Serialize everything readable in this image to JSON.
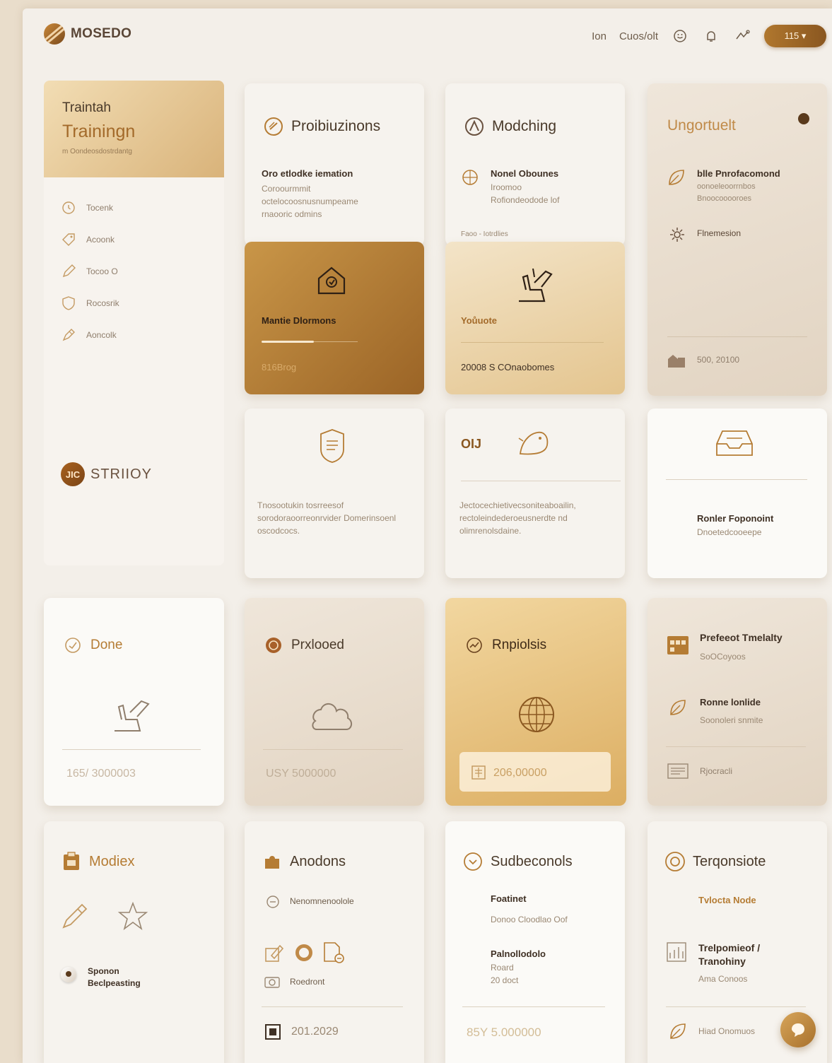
{
  "header": {
    "logo_text": "MOSEDO",
    "nav_links": [
      "Ion",
      "Cuos/olt"
    ],
    "pill_label": "115 ▾"
  },
  "sidebar": {
    "head_title": "Traintah",
    "head_big": "Trainingn",
    "head_sub": "m Oondeosdostrdantg",
    "items": [
      {
        "label": "Tocenk"
      },
      {
        "label": "Acoonk"
      },
      {
        "label": "Tocoo O"
      },
      {
        "label": "Rocosrik"
      },
      {
        "label": "Aoncolk"
      }
    ],
    "brand_badge": "JIC",
    "brand_text": "STRIIOY"
  },
  "cards": {
    "proiputzinons": {
      "title": "Proibiuzinons",
      "item_title": "Oro etlodke iemation",
      "item_lines": [
        "Coroourmmit",
        "octelocoosnusnumpeame",
        "rnaooric odmins"
      ]
    },
    "mantie": {
      "title": "Mantie Dlormons",
      "value": "816Brog"
    },
    "modching": {
      "title": "Modching",
      "item_title": "Nonel Obounes",
      "item_lines": [
        "Iroomoo",
        "Rofiondeodode lof"
      ],
      "meta": "Faoo - Iotrdlies"
    },
    "youdote": {
      "title": "Yoůuote",
      "value": "20008 S COnaobomes"
    },
    "ungortuelt": {
      "title": "Ungortuelt",
      "item1_title": "blle Pnrofacomond",
      "item1_lines": [
        "oonoeleoorrnbos",
        "Bnoocooooroes"
      ],
      "item2": "Flnemesion",
      "footer": "500, 20100"
    },
    "row2a": {
      "text": "Tnosootukin tosrreesof sorodoraoorreonrvider Domerinsoenl oscodcocs."
    },
    "row2b": {
      "num": "OIJ",
      "text": "Jectocechietivecsoniteaboailin, rectoleindederoeusnerdte nd olimrenolsdaine."
    },
    "row2c": {
      "title": "Ronler Foponoint",
      "sub": "Dnoetedcooeepe"
    },
    "done": {
      "title": "Done",
      "value": "165/ 3000003"
    },
    "prxlooed": {
      "title": "Prxlooed",
      "value": "USY 5000000"
    },
    "rnpiolsis": {
      "title": "Rnpiolsis",
      "value": "206,00000"
    },
    "prefeet": {
      "item1_title": "Prefeeot Tmelalty",
      "item1_sub": "SoOCoyoos",
      "item2_title": "Ronne lonlide",
      "item2_sub": "Soonoleri snmite",
      "item3": "Rjocracli"
    },
    "modiex": {
      "title": "Modiex",
      "toggle_label_1": "Sponon",
      "toggle_label_2": "Beclpeasting"
    },
    "anodons": {
      "title": "Anodons",
      "item1": "Nenomnenoolole",
      "item2": "Roedront",
      "footer": "201.2029"
    },
    "sudbecon": {
      "title": "Sudbeconols",
      "item1_title": "Foatinet",
      "item1_sub": "Donoo Cloodlao Oof",
      "item2_title": "Palnollodolo",
      "item2_sub1": "Roard",
      "item2_sub2": "20 doct",
      "footer": "85Y 5.000000"
    },
    "terqonsiote": {
      "title": "Terqonsiote",
      "item1": "Tvlocta Node",
      "item2_title_1": "Trelpomieof /",
      "item2_title_2": "Tranohiny",
      "item2_sub": "Ama Conoos",
      "footer": "Hiad Onomuos"
    }
  },
  "colors": {
    "accent": "#b57c34",
    "brown": "#9b6426",
    "gold": "#dcae62",
    "background": "#f3efe9"
  }
}
